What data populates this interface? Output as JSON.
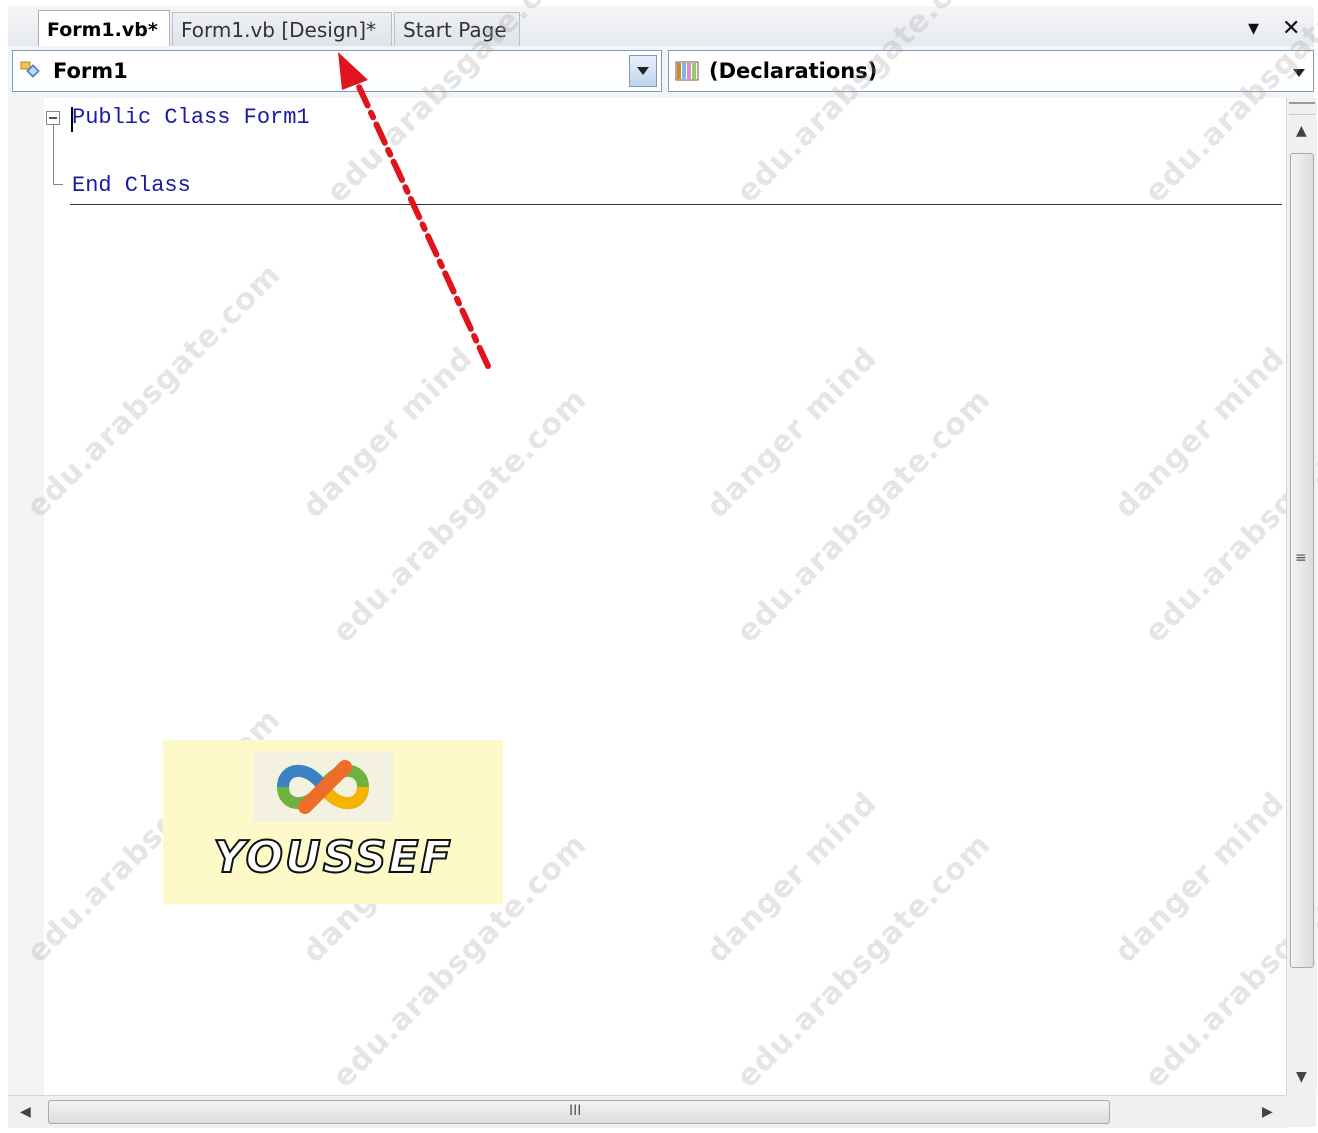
{
  "tabs": [
    {
      "label": "Form1.vb*",
      "active": true
    },
    {
      "label": "Form1.vb [Design]*",
      "active": false
    },
    {
      "label": "Start Page",
      "active": false
    }
  ],
  "tab_controls": {
    "dropdown_icon": "chevron-down-icon",
    "close_icon": "close-icon",
    "close_label": "✕",
    "dropdown_label": "▾"
  },
  "navbar": {
    "class_combo": {
      "value": "Form1",
      "icon": "class-icon"
    },
    "member_combo": {
      "value": "(Declarations)",
      "icon": "declarations-icon"
    }
  },
  "code": {
    "line1": {
      "keyword": "Public Class",
      "name": "Form1"
    },
    "line3": {
      "keyword": "End Class"
    }
  },
  "watermarks": [
    "danger mind",
    "edu.arabsgate.com"
  ],
  "logo": {
    "text": "YOUSSEF"
  },
  "scrollbars": {
    "grip": "III",
    "v_grip": "≡"
  },
  "colors": {
    "keyword": "#1a1aa8",
    "arrow": "#e0141c",
    "logo_bg": "#fdf9c8"
  }
}
